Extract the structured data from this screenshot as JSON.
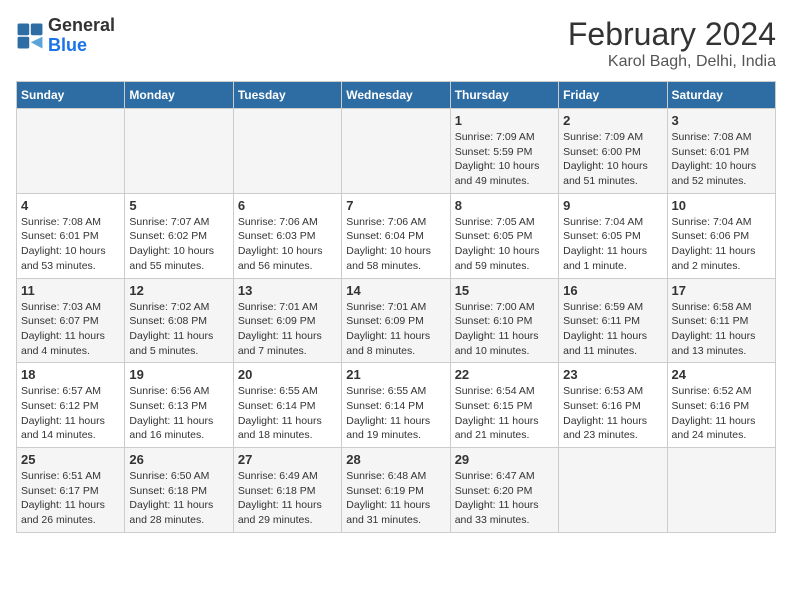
{
  "logo": {
    "text_general": "General",
    "text_blue": "Blue"
  },
  "title": "February 2024",
  "subtitle": "Karol Bagh, Delhi, India",
  "weekdays": [
    "Sunday",
    "Monday",
    "Tuesday",
    "Wednesday",
    "Thursday",
    "Friday",
    "Saturday"
  ],
  "weeks": [
    [
      {
        "day": "",
        "info": ""
      },
      {
        "day": "",
        "info": ""
      },
      {
        "day": "",
        "info": ""
      },
      {
        "day": "",
        "info": ""
      },
      {
        "day": "1",
        "info": "Sunrise: 7:09 AM\nSunset: 5:59 PM\nDaylight: 10 hours\nand 49 minutes."
      },
      {
        "day": "2",
        "info": "Sunrise: 7:09 AM\nSunset: 6:00 PM\nDaylight: 10 hours\nand 51 minutes."
      },
      {
        "day": "3",
        "info": "Sunrise: 7:08 AM\nSunset: 6:01 PM\nDaylight: 10 hours\nand 52 minutes."
      }
    ],
    [
      {
        "day": "4",
        "info": "Sunrise: 7:08 AM\nSunset: 6:01 PM\nDaylight: 10 hours\nand 53 minutes."
      },
      {
        "day": "5",
        "info": "Sunrise: 7:07 AM\nSunset: 6:02 PM\nDaylight: 10 hours\nand 55 minutes."
      },
      {
        "day": "6",
        "info": "Sunrise: 7:06 AM\nSunset: 6:03 PM\nDaylight: 10 hours\nand 56 minutes."
      },
      {
        "day": "7",
        "info": "Sunrise: 7:06 AM\nSunset: 6:04 PM\nDaylight: 10 hours\nand 58 minutes."
      },
      {
        "day": "8",
        "info": "Sunrise: 7:05 AM\nSunset: 6:05 PM\nDaylight: 10 hours\nand 59 minutes."
      },
      {
        "day": "9",
        "info": "Sunrise: 7:04 AM\nSunset: 6:05 PM\nDaylight: 11 hours\nand 1 minute."
      },
      {
        "day": "10",
        "info": "Sunrise: 7:04 AM\nSunset: 6:06 PM\nDaylight: 11 hours\nand 2 minutes."
      }
    ],
    [
      {
        "day": "11",
        "info": "Sunrise: 7:03 AM\nSunset: 6:07 PM\nDaylight: 11 hours\nand 4 minutes."
      },
      {
        "day": "12",
        "info": "Sunrise: 7:02 AM\nSunset: 6:08 PM\nDaylight: 11 hours\nand 5 minutes."
      },
      {
        "day": "13",
        "info": "Sunrise: 7:01 AM\nSunset: 6:09 PM\nDaylight: 11 hours\nand 7 minutes."
      },
      {
        "day": "14",
        "info": "Sunrise: 7:01 AM\nSunset: 6:09 PM\nDaylight: 11 hours\nand 8 minutes."
      },
      {
        "day": "15",
        "info": "Sunrise: 7:00 AM\nSunset: 6:10 PM\nDaylight: 11 hours\nand 10 minutes."
      },
      {
        "day": "16",
        "info": "Sunrise: 6:59 AM\nSunset: 6:11 PM\nDaylight: 11 hours\nand 11 minutes."
      },
      {
        "day": "17",
        "info": "Sunrise: 6:58 AM\nSunset: 6:11 PM\nDaylight: 11 hours\nand 13 minutes."
      }
    ],
    [
      {
        "day": "18",
        "info": "Sunrise: 6:57 AM\nSunset: 6:12 PM\nDaylight: 11 hours\nand 14 minutes."
      },
      {
        "day": "19",
        "info": "Sunrise: 6:56 AM\nSunset: 6:13 PM\nDaylight: 11 hours\nand 16 minutes."
      },
      {
        "day": "20",
        "info": "Sunrise: 6:55 AM\nSunset: 6:14 PM\nDaylight: 11 hours\nand 18 minutes."
      },
      {
        "day": "21",
        "info": "Sunrise: 6:55 AM\nSunset: 6:14 PM\nDaylight: 11 hours\nand 19 minutes."
      },
      {
        "day": "22",
        "info": "Sunrise: 6:54 AM\nSunset: 6:15 PM\nDaylight: 11 hours\nand 21 minutes."
      },
      {
        "day": "23",
        "info": "Sunrise: 6:53 AM\nSunset: 6:16 PM\nDaylight: 11 hours\nand 23 minutes."
      },
      {
        "day": "24",
        "info": "Sunrise: 6:52 AM\nSunset: 6:16 PM\nDaylight: 11 hours\nand 24 minutes."
      }
    ],
    [
      {
        "day": "25",
        "info": "Sunrise: 6:51 AM\nSunset: 6:17 PM\nDaylight: 11 hours\nand 26 minutes."
      },
      {
        "day": "26",
        "info": "Sunrise: 6:50 AM\nSunset: 6:18 PM\nDaylight: 11 hours\nand 28 minutes."
      },
      {
        "day": "27",
        "info": "Sunrise: 6:49 AM\nSunset: 6:18 PM\nDaylight: 11 hours\nand 29 minutes."
      },
      {
        "day": "28",
        "info": "Sunrise: 6:48 AM\nSunset: 6:19 PM\nDaylight: 11 hours\nand 31 minutes."
      },
      {
        "day": "29",
        "info": "Sunrise: 6:47 AM\nSunset: 6:20 PM\nDaylight: 11 hours\nand 33 minutes."
      },
      {
        "day": "",
        "info": ""
      },
      {
        "day": "",
        "info": ""
      }
    ]
  ]
}
